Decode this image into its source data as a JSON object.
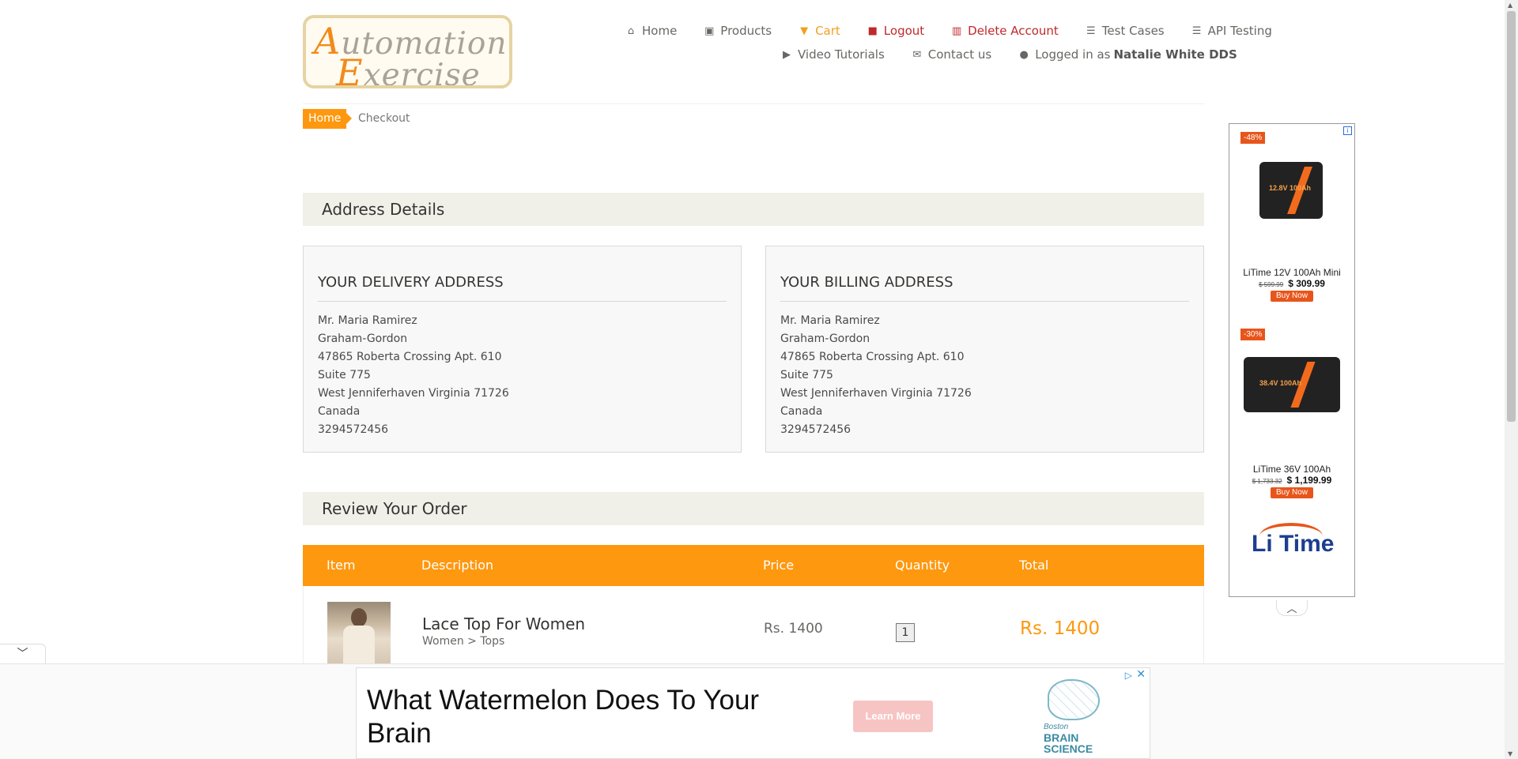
{
  "logo": {
    "line1_cap": "A",
    "line1_rest": "utomation",
    "line2_cap": "E",
    "line2_rest": "xercise"
  },
  "nav": {
    "home": {
      "label": "Home",
      "icon": "home-icon"
    },
    "products": {
      "label": "Products",
      "icon": "briefcase-icon"
    },
    "cart": {
      "label": "Cart",
      "icon": "shopping-cart-icon"
    },
    "logout": {
      "label": "Logout",
      "icon": "lock-icon"
    },
    "delete_account": {
      "label": "Delete Account",
      "icon": "trash-icon"
    },
    "test_cases": {
      "label": "Test Cases",
      "icon": "list-icon"
    },
    "api_testing": {
      "label": "API Testing",
      "icon": "list-icon"
    },
    "video_tutorials": {
      "label": "Video Tutorials",
      "icon": "youtube-play-icon"
    },
    "contact_us": {
      "label": "Contact us",
      "icon": "envelope-icon"
    },
    "logged_in_prefix": "Logged in as",
    "logged_in_user": "Natalie White DDS",
    "user_icon": "user-icon"
  },
  "breadcrumb": {
    "home": "Home",
    "current": "Checkout"
  },
  "address_section": {
    "title": "Address Details"
  },
  "delivery": {
    "title": "Your delivery address",
    "lines": [
      "Mr. Maria Ramirez",
      "Graham-Gordon",
      "47865 Roberta Crossing Apt. 610",
      "Suite 775",
      "West Jenniferhaven Virginia 71726",
      "Canada",
      "3294572456"
    ]
  },
  "billing": {
    "title": "Your billing address",
    "lines": [
      "Mr. Maria Ramirez",
      "Graham-Gordon",
      "47865 Roberta Crossing Apt. 610",
      "Suite 775",
      "West Jenniferhaven Virginia 71726",
      "Canada",
      "3294572456"
    ]
  },
  "review_section": {
    "title": "Review Your Order"
  },
  "table": {
    "headers": {
      "item": "Item",
      "description": "Description",
      "price": "Price",
      "quantity": "Quantity",
      "total": "Total"
    },
    "rows": [
      {
        "name": "Lace Top For Women",
        "category": "Women > Tops",
        "price": "Rs. 1400",
        "quantity": "1",
        "total": "Rs. 1400"
      }
    ]
  },
  "side_ad": {
    "info": "i",
    "item1": {
      "badge": "-48%",
      "battery_label": "12.8V 100Ah",
      "name": "LiTime 12V 100Ah Mini",
      "old_price": "$ 599.99",
      "price": "$ 309.99",
      "button": "Buy Now"
    },
    "item2": {
      "badge": "-30%",
      "battery_label": "38.4V 100Ah",
      "name": "LiTime 36V 100Ah",
      "old_price": "$ 1,733.32",
      "price": "$ 1,199.99",
      "button": "Buy Now"
    },
    "brand": "Li Time",
    "collapse_icon": "chevron-up-icon"
  },
  "bottom_ad": {
    "headline": "What Watermelon Does To Your Brain",
    "button": "Learn More",
    "brand_line1": "Boston",
    "brand_line2": "BRAIN",
    "brand_line3": "SCIENCE",
    "adchoices_icon": "adchoices-icon",
    "close_icon": "close-icon",
    "toggle_icon": "chevron-down-icon"
  },
  "colors": {
    "accent": "#fe980f",
    "logout_red": "#c0292b",
    "section_bg": "#f0f0e9"
  }
}
